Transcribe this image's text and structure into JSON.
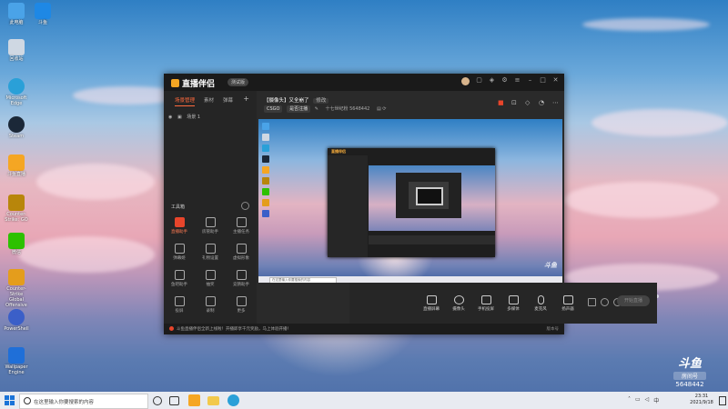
{
  "desktop_icons": [
    {
      "label": "此电脑",
      "icon": "computer-icon",
      "color": "#4aa3e8"
    },
    {
      "label": "回收站",
      "icon": "recycle-bin-icon",
      "color": "#cfd8e3"
    },
    {
      "label": "Microsoft Edge",
      "icon": "edge-icon",
      "color": "#2aa0d8"
    },
    {
      "label": "Steam",
      "icon": "steam-icon",
      "color": "#1b2838"
    },
    {
      "label": "斗鱼直播",
      "icon": "douyu-icon",
      "color": "#f5a623"
    },
    {
      "label": "Counter-Strike: GO",
      "icon": "csgo-icon",
      "color": "#b8860b"
    },
    {
      "label": "微信",
      "icon": "wechat-icon",
      "color": "#2dc100"
    },
    {
      "label": "Counter-Strike Global Offensive",
      "icon": "csgo2-icon",
      "color": "#e49d1c"
    },
    {
      "label": "PowerShell",
      "icon": "app-icon",
      "color": "#3b5fc8"
    },
    {
      "label": "Wallpaper Engine",
      "icon": "wallpaper-icon",
      "color": "#1f6fd8"
    }
  ],
  "desktop_top_extra": {
    "label": "斗鱼",
    "icon": "bird-icon"
  },
  "app": {
    "name": "直播伴侣",
    "version_badge": "测试版",
    "left_tabs": [
      "场景管理",
      "素材",
      "弹幕"
    ],
    "scene_item": "场景 1",
    "tools_title": "工具箱",
    "tools": [
      {
        "label": "直播助手",
        "hot": true
      },
      {
        "label": "房管助手",
        "hot": false
      },
      {
        "label": "主播任务",
        "hot": false
      },
      {
        "label": "弹幕姬",
        "hot": false
      },
      {
        "label": "礼物设置",
        "hot": false
      },
      {
        "label": "虚拟形象",
        "hot": false
      },
      {
        "label": "鱼吧助手",
        "hot": false
      },
      {
        "label": "抽奖",
        "hot": false
      },
      {
        "label": "竞猜助手",
        "hot": false
      },
      {
        "label": "投屏",
        "hot": false
      },
      {
        "label": "录制",
        "hot": false
      },
      {
        "label": "更多",
        "hot": false
      }
    ],
    "room_title": "【摄像头】又全崩了",
    "room_title_tag": "修改",
    "room_category": "CSGO",
    "room_category_btn": "是否注播",
    "room_meta": "十七世纪粉  5648442",
    "bottom_buttons": [
      "直播屏幕",
      "摄像头",
      "手机投屏",
      "多媒体",
      "麦克风",
      "扬声器"
    ],
    "start_button": "开始直播",
    "status_message": "斗鱼直播伴侣全新上线啦！开播即享千元奖励，马上体验开播！",
    "status_right": "版本号"
  },
  "watermark": {
    "brand": "斗鱼",
    "room_label": "房间号",
    "room_id": "5648442"
  },
  "taskbar": {
    "search_placeholder": "在这里输入你要搜索的内容",
    "time": "23:31",
    "date": "2021/9/18"
  }
}
